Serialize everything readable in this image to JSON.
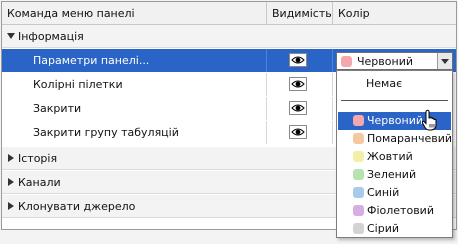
{
  "header": {
    "command": "Команда меню панелі",
    "visibility": "Видимість",
    "color": "Колір"
  },
  "groups": [
    {
      "label": "Інформація",
      "expanded": true
    },
    {
      "label": "Історія",
      "expanded": false
    },
    {
      "label": "Канали",
      "expanded": false
    },
    {
      "label": "Клонувати джерело",
      "expanded": false
    }
  ],
  "info_items": [
    {
      "label": "Параметри панелі...",
      "selected": true
    },
    {
      "label": "Колірні пілетки",
      "selected": false
    },
    {
      "label": "Закрити",
      "selected": false
    },
    {
      "label": "Закрити групу табуляцій",
      "selected": false
    }
  ],
  "color_dropdown": {
    "value": "Червоний",
    "value_color": "#f6a7ab"
  },
  "color_menu": {
    "none_label": "Немає",
    "items": [
      {
        "label": "Червоний",
        "color": "#f6a7ab",
        "highlighted": true
      },
      {
        "label": "Помаранчевий",
        "color": "#f5c9a0",
        "highlighted": false
      },
      {
        "label": "Жовтий",
        "color": "#f2f0a8",
        "highlighted": false
      },
      {
        "label": "Зелений",
        "color": "#b7e2b2",
        "highlighted": false
      },
      {
        "label": "Синій",
        "color": "#a9cbea",
        "highlighted": false
      },
      {
        "label": "Фіолетовий",
        "color": "#d6aee2",
        "highlighted": false
      },
      {
        "label": "Сірий",
        "color": "#d3d3d3",
        "highlighted": false
      }
    ]
  },
  "accent": "#2a64c6"
}
